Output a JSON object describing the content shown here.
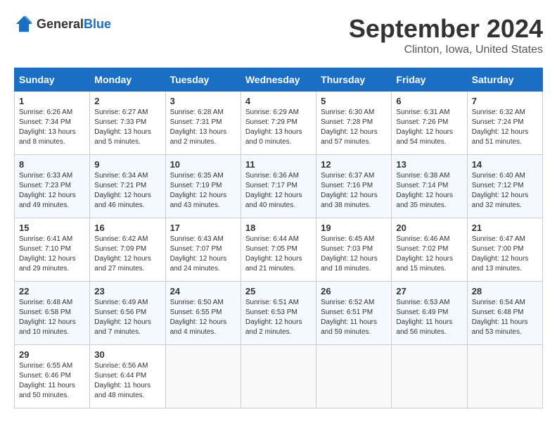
{
  "logo": {
    "general": "General",
    "blue": "Blue"
  },
  "header": {
    "month": "September 2024",
    "location": "Clinton, Iowa, United States"
  },
  "weekdays": [
    "Sunday",
    "Monday",
    "Tuesday",
    "Wednesday",
    "Thursday",
    "Friday",
    "Saturday"
  ],
  "weeks": [
    [
      {
        "day": "1",
        "sunrise": "6:26 AM",
        "sunset": "7:34 PM",
        "daylight": "13 hours and 8 minutes."
      },
      {
        "day": "2",
        "sunrise": "6:27 AM",
        "sunset": "7:33 PM",
        "daylight": "13 hours and 5 minutes."
      },
      {
        "day": "3",
        "sunrise": "6:28 AM",
        "sunset": "7:31 PM",
        "daylight": "13 hours and 2 minutes."
      },
      {
        "day": "4",
        "sunrise": "6:29 AM",
        "sunset": "7:29 PM",
        "daylight": "13 hours and 0 minutes."
      },
      {
        "day": "5",
        "sunrise": "6:30 AM",
        "sunset": "7:28 PM",
        "daylight": "12 hours and 57 minutes."
      },
      {
        "day": "6",
        "sunrise": "6:31 AM",
        "sunset": "7:26 PM",
        "daylight": "12 hours and 54 minutes."
      },
      {
        "day": "7",
        "sunrise": "6:32 AM",
        "sunset": "7:24 PM",
        "daylight": "12 hours and 51 minutes."
      }
    ],
    [
      {
        "day": "8",
        "sunrise": "6:33 AM",
        "sunset": "7:23 PM",
        "daylight": "12 hours and 49 minutes."
      },
      {
        "day": "9",
        "sunrise": "6:34 AM",
        "sunset": "7:21 PM",
        "daylight": "12 hours and 46 minutes."
      },
      {
        "day": "10",
        "sunrise": "6:35 AM",
        "sunset": "7:19 PM",
        "daylight": "12 hours and 43 minutes."
      },
      {
        "day": "11",
        "sunrise": "6:36 AM",
        "sunset": "7:17 PM",
        "daylight": "12 hours and 40 minutes."
      },
      {
        "day": "12",
        "sunrise": "6:37 AM",
        "sunset": "7:16 PM",
        "daylight": "12 hours and 38 minutes."
      },
      {
        "day": "13",
        "sunrise": "6:38 AM",
        "sunset": "7:14 PM",
        "daylight": "12 hours and 35 minutes."
      },
      {
        "day": "14",
        "sunrise": "6:40 AM",
        "sunset": "7:12 PM",
        "daylight": "12 hours and 32 minutes."
      }
    ],
    [
      {
        "day": "15",
        "sunrise": "6:41 AM",
        "sunset": "7:10 PM",
        "daylight": "12 hours and 29 minutes."
      },
      {
        "day": "16",
        "sunrise": "6:42 AM",
        "sunset": "7:09 PM",
        "daylight": "12 hours and 27 minutes."
      },
      {
        "day": "17",
        "sunrise": "6:43 AM",
        "sunset": "7:07 PM",
        "daylight": "12 hours and 24 minutes."
      },
      {
        "day": "18",
        "sunrise": "6:44 AM",
        "sunset": "7:05 PM",
        "daylight": "12 hours and 21 minutes."
      },
      {
        "day": "19",
        "sunrise": "6:45 AM",
        "sunset": "7:03 PM",
        "daylight": "12 hours and 18 minutes."
      },
      {
        "day": "20",
        "sunrise": "6:46 AM",
        "sunset": "7:02 PM",
        "daylight": "12 hours and 15 minutes."
      },
      {
        "day": "21",
        "sunrise": "6:47 AM",
        "sunset": "7:00 PM",
        "daylight": "12 hours and 13 minutes."
      }
    ],
    [
      {
        "day": "22",
        "sunrise": "6:48 AM",
        "sunset": "6:58 PM",
        "daylight": "12 hours and 10 minutes."
      },
      {
        "day": "23",
        "sunrise": "6:49 AM",
        "sunset": "6:56 PM",
        "daylight": "12 hours and 7 minutes."
      },
      {
        "day": "24",
        "sunrise": "6:50 AM",
        "sunset": "6:55 PM",
        "daylight": "12 hours and 4 minutes."
      },
      {
        "day": "25",
        "sunrise": "6:51 AM",
        "sunset": "6:53 PM",
        "daylight": "12 hours and 2 minutes."
      },
      {
        "day": "26",
        "sunrise": "6:52 AM",
        "sunset": "6:51 PM",
        "daylight": "11 hours and 59 minutes."
      },
      {
        "day": "27",
        "sunrise": "6:53 AM",
        "sunset": "6:49 PM",
        "daylight": "11 hours and 56 minutes."
      },
      {
        "day": "28",
        "sunrise": "6:54 AM",
        "sunset": "6:48 PM",
        "daylight": "11 hours and 53 minutes."
      }
    ],
    [
      {
        "day": "29",
        "sunrise": "6:55 AM",
        "sunset": "6:46 PM",
        "daylight": "11 hours and 50 minutes."
      },
      {
        "day": "30",
        "sunrise": "6:56 AM",
        "sunset": "6:44 PM",
        "daylight": "11 hours and 48 minutes."
      },
      null,
      null,
      null,
      null,
      null
    ]
  ]
}
